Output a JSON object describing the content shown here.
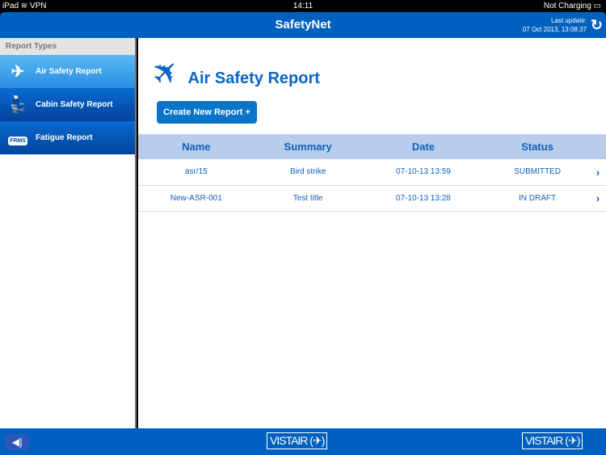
{
  "status": {
    "device": "iPad",
    "vpn": "VPN",
    "time": "14:11",
    "battery": "Not Charging"
  },
  "nav": {
    "title": "SafetyNet",
    "last_update_label": "Last update:",
    "last_update": "07 Oct 2013, 13:08:37"
  },
  "sidebar": {
    "header": "Report Types",
    "items": [
      {
        "label": "Air Safety Report"
      },
      {
        "label": "Cabin Safety Report"
      },
      {
        "label": "Fatigue Report",
        "badge": "FRMS"
      }
    ]
  },
  "main": {
    "title": "Air Safety Report",
    "create_button": "Create New Report +",
    "columns": [
      "Name",
      "Summary",
      "Date",
      "Status"
    ],
    "rows": [
      {
        "name": "asr/15",
        "summary": "Bird strike",
        "date": "07-10-13 13:59",
        "status": "SUBMITTED"
      },
      {
        "name": "New-ASR-001",
        "summary": "Test title",
        "date": "07-10-13 13:28",
        "status": "IN DRAFT"
      }
    ]
  },
  "footer": {
    "logo": "VISTAIR"
  }
}
